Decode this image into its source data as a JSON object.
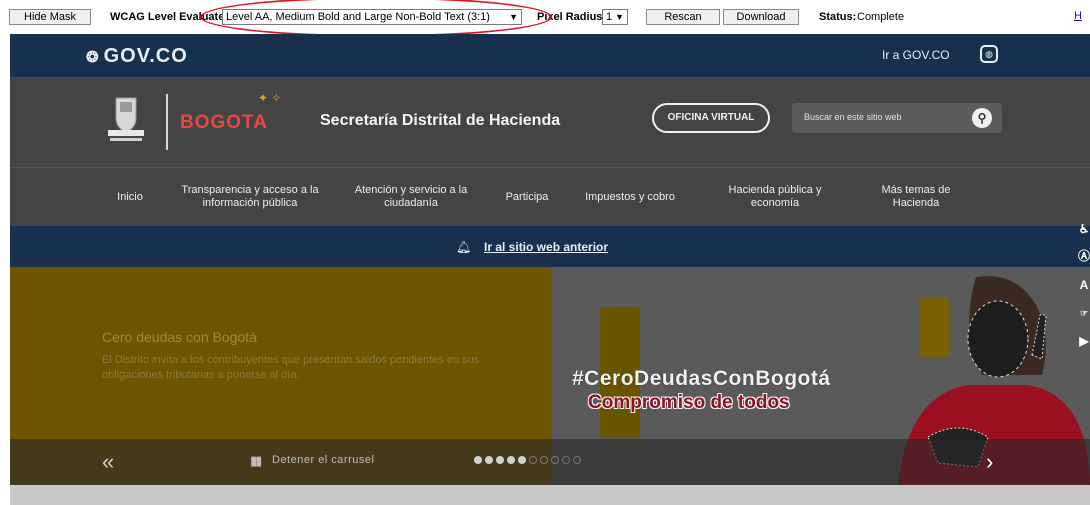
{
  "toolbar": {
    "hide_mask": "Hide Mask",
    "wcag_label": "WCAG Level Evaluated:",
    "wcag_value": "Level AA, Medium Bold and Large Non-Bold Text (3:1)",
    "pixel_label": "Pixel Radius:",
    "pixel_value": "1",
    "rescan": "Rescan",
    "download": "Download",
    "status_label": "Status:",
    "status_value": "Complete",
    "edge_link": "H"
  },
  "govbar": {
    "logo": "GOV.CO",
    "link": "Ir a GOV.CO"
  },
  "header": {
    "brand": "BOGOTA",
    "secretaria": "Secretaría Distrital de Hacienda",
    "oficina": "OFICINA VIRTUAL",
    "search_placeholder": "Buscar en este sitio web"
  },
  "nav": [
    {
      "label": "Inicio"
    },
    {
      "label": "Transparencia y acceso a la información pública"
    },
    {
      "label": "Atención y servicio a la ciudadanía"
    },
    {
      "label": "Participa"
    },
    {
      "label": "Impuestos y cobro"
    },
    {
      "label": "Hacienda pública y economía"
    },
    {
      "label": "Más temas de Hacienda"
    }
  ],
  "linkbar": {
    "text": "Ir al sitio web anterior"
  },
  "carousel": {
    "title": "Cero deudas con Bogotá",
    "description": "El Distrito invita a los contribuyentes que presentan saldos pendientes en sus obligaciones tributarias a ponerse al día.",
    "hashtag": "#CeroDeudasConBogotá",
    "tagline": "Compromiso de todos",
    "pause": "Detener el carrusel",
    "slide_count": 10,
    "active_slide": 5
  },
  "colors": {
    "gov_blue": "#18304d",
    "header_gray": "#444444",
    "brand_red": "#e64a3f",
    "mask_yellow": "#6e5300",
    "annotation_red": "#e0141e"
  },
  "icons": [
    "shield-icon",
    "sign-language-icon",
    "search-icon",
    "bell-icon",
    "chevron-left-icon",
    "pause-icon",
    "chevron-right-icon",
    "accessibility-icon",
    "contrast-icon",
    "text-size-icon",
    "audio-icon"
  ]
}
